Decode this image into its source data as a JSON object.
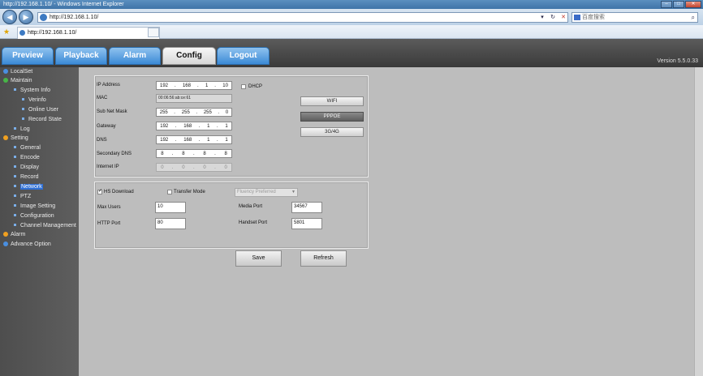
{
  "browser": {
    "window_title": "http://192.168.1.10/ - Windows Internet Explorer",
    "url": "http://192.168.1.10/",
    "tab_title": "http://192.168.1.10/",
    "search_placeholder": "百度搜索",
    "win_min": "–",
    "win_max": "□",
    "win_close": "✕",
    "back_glyph": "◀",
    "fwd_glyph": "▶",
    "dropdown_glyph": "▾",
    "refresh_glyph": "↻",
    "stop_glyph": "✕",
    "search_glyph": "⌕",
    "star_glyph": "★"
  },
  "nav": {
    "tabs": [
      {
        "label": "Preview"
      },
      {
        "label": "Playback"
      },
      {
        "label": "Alarm"
      },
      {
        "label": "Config"
      },
      {
        "label": "Logout"
      }
    ],
    "active": "Config",
    "version": "Version 5.5.0.33"
  },
  "sidebar": {
    "items": [
      {
        "label": "LocalSet"
      },
      {
        "label": "Maintain"
      },
      {
        "label": "System Info"
      },
      {
        "label": "Verinfo"
      },
      {
        "label": "Online User"
      },
      {
        "label": "Record State"
      },
      {
        "label": "Log"
      },
      {
        "label": "Setting"
      },
      {
        "label": "General"
      },
      {
        "label": "Encode"
      },
      {
        "label": "Display"
      },
      {
        "label": "Record"
      },
      {
        "label": "Network"
      },
      {
        "label": "PTZ"
      },
      {
        "label": "Image Setting"
      },
      {
        "label": "Configuration"
      },
      {
        "label": "Channel Management"
      },
      {
        "label": "Alarm"
      },
      {
        "label": "Advance Option"
      }
    ],
    "selected": "Network"
  },
  "network": {
    "labels": {
      "ip": "IP Address",
      "mac": "MAC",
      "subnet": "Sub Net Mask",
      "gateway": "Gateway",
      "dns": "DNS",
      "dns2": "Secondary DNS",
      "internet_ip": "Internet IP",
      "dhcp": "DHCP"
    },
    "ip": [
      "192",
      "168",
      "1",
      "10"
    ],
    "mac": "00:06:56:ab:ce:61",
    "subnet": [
      "255",
      "255",
      "255",
      "0"
    ],
    "gateway": [
      "192",
      "168",
      "1",
      "1"
    ],
    "dns": [
      "192",
      "168",
      "1",
      "1"
    ],
    "dns2": [
      "8",
      "8",
      "8",
      "8"
    ],
    "internet_ip": [
      "0",
      "0",
      "0",
      "0"
    ],
    "buttons": {
      "wifi": "WIFI",
      "pppoe": "PPPOE",
      "g34": "3G/4G"
    }
  },
  "ports": {
    "hs_download": "HS Download",
    "transfer_mode": "Transfer Mode",
    "fluency": "Fluency Preferred",
    "max_users_label": "Max Users",
    "max_users": "10",
    "http_port_label": "HTTP Port",
    "http_port": "80",
    "media_port_label": "Media Port",
    "media_port": "34567",
    "handset_port_label": "Handset Port",
    "handset_port": "5801"
  },
  "actions": {
    "save": "Save",
    "refresh": "Refresh"
  },
  "colors": {
    "tab_blue": "#3c8ad6",
    "header_dark": "#3a3a3a",
    "selected": "#2f6fd4"
  }
}
